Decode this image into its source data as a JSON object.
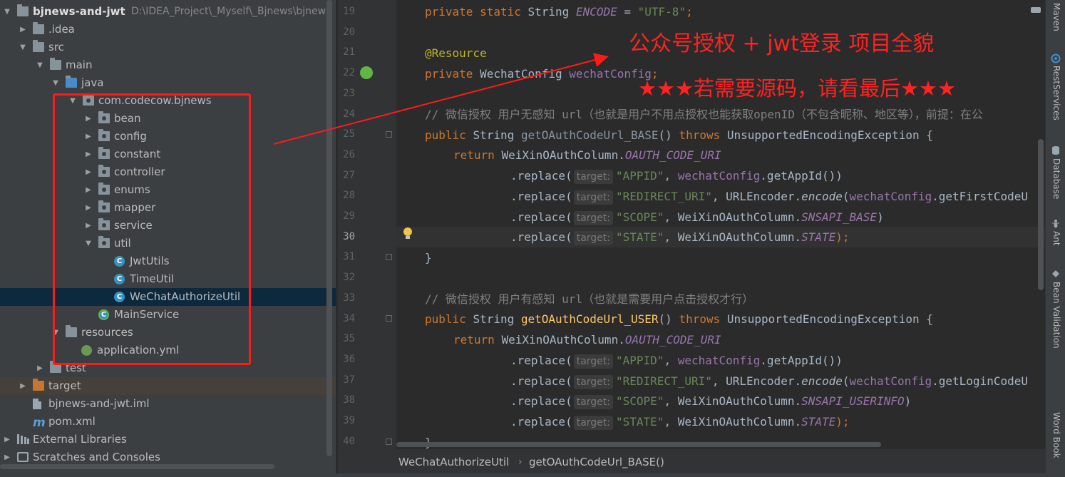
{
  "project_tree": {
    "rows": [
      {
        "label": "bjnews-and-jwt",
        "path": "D:\\IDEA_Project\\_Myself\\_Bjnews\\bjnews",
        "arrow": "down",
        "icon": "folder"
      },
      {
        "label": ".idea",
        "arrow": "right",
        "icon": "folder"
      },
      {
        "label": "src",
        "arrow": "down",
        "icon": "folder"
      },
      {
        "label": "main",
        "arrow": "down",
        "icon": "folder"
      },
      {
        "label": "java",
        "arrow": "down",
        "icon": "folder-source"
      },
      {
        "label": "com.codecow.bjnews",
        "arrow": "down",
        "icon": "package"
      },
      {
        "label": "bean",
        "arrow": "right",
        "icon": "package"
      },
      {
        "label": "config",
        "arrow": "right",
        "icon": "package"
      },
      {
        "label": "constant",
        "arrow": "right",
        "icon": "package"
      },
      {
        "label": "controller",
        "arrow": "right",
        "icon": "package"
      },
      {
        "label": "enums",
        "arrow": "right",
        "icon": "package"
      },
      {
        "label": "mapper",
        "arrow": "right",
        "icon": "package"
      },
      {
        "label": "service",
        "arrow": "right",
        "icon": "package"
      },
      {
        "label": "util",
        "arrow": "down",
        "icon": "package"
      },
      {
        "label": "JwtUtils",
        "icon": "class"
      },
      {
        "label": "TimeUtil",
        "icon": "class"
      },
      {
        "label": "WeChatAuthorizeUtil",
        "icon": "class",
        "selected": true
      },
      {
        "label": "MainService",
        "icon": "spring-class"
      },
      {
        "label": "resources",
        "arrow": "down",
        "icon": "folder-resources"
      },
      {
        "label": "application.yml",
        "icon": "spring-yml"
      },
      {
        "label": "test",
        "arrow": "right",
        "icon": "folder"
      },
      {
        "label": "target",
        "arrow": "right",
        "icon": "folder-excluded",
        "highlight": true
      },
      {
        "label": "bjnews-and-jwt.iml",
        "icon": "file"
      },
      {
        "label": "pom.xml",
        "icon": "maven"
      },
      {
        "label": "External Libraries",
        "arrow": "right",
        "icon": "libraries"
      },
      {
        "label": "Scratches and Consoles",
        "arrow": "right",
        "icon": "scratches"
      }
    ]
  },
  "editor": {
    "line_numbers": [
      "19",
      "20",
      "21",
      "22",
      "23",
      "24",
      "25",
      "26",
      "27",
      "28",
      "29",
      "30",
      "31",
      "32",
      "33",
      "34",
      "35",
      "36",
      "37",
      "38",
      "39",
      "40"
    ],
    "current_line": "30",
    "hint_label": "target:",
    "code": {
      "l19": {
        "kw": "private static ",
        "type": "String ",
        "field": "ENCODE",
        "eq": " = ",
        "str": "\"UTF-8\"",
        "semi": ";"
      },
      "l21": {
        "annotation": "@Resource"
      },
      "l22": {
        "kw": "private ",
        "type": "WechatConfig ",
        "field": "wechatConfig",
        "semi": ";"
      },
      "l24": {
        "comment": "// 微信授权 用户无感知 url（也就是用户不用点授权也能获取openID（不包含昵称、地区等），前提：在公"
      },
      "l25": {
        "kw": "public ",
        "type": "String ",
        "method": "getOAuthCodeUrl_BASE",
        "paren": "() ",
        "kw2": "throws ",
        "exc": "UnsupportedEncodingException {"
      },
      "l26": {
        "kw": "return ",
        "cls": "WeiXinOAuthColumn.",
        "const": "OAUTH_CODE_URI"
      },
      "l27": {
        "call": ".replace(",
        "str": "\"APPID\"",
        "comma": ", ",
        "obj": "wechatConfig",
        "rest": ".getAppId())"
      },
      "l28": {
        "call": ".replace(",
        "str": "\"REDIRECT_URI\"",
        "comma": ", ",
        "cls": "URLEncoder.",
        "static": "encode",
        "open": "(",
        "obj": "wechatConfig",
        "rest": ".getFirstCodeU"
      },
      "l29": {
        "call": ".replace(",
        "str": "\"SCOPE\"",
        "comma": ", ",
        "cls": "WeiXinOAuthColumn.",
        "const": "SNSAPI_BASE",
        "close": ")"
      },
      "l30": {
        "call": ".replace(",
        "str": "\"STATE\"",
        "comma": ", ",
        "cls": "WeiXinOAuthColumn.",
        "const": "STATE",
        "close": ");"
      },
      "l31": {
        "brace": "}"
      },
      "l33": {
        "comment": "// 微信授权 用户有感知 url（也就是需要用户点击授权才行）"
      },
      "l34": {
        "kw": "public ",
        "type": "String ",
        "method": "getOAuthCodeUrl_USER",
        "paren": "() ",
        "kw2": "throws ",
        "exc": "UnsupportedEncodingException {"
      },
      "l35": {
        "kw": "return ",
        "cls": "WeiXinOAuthColumn.",
        "const": "OAUTH_CODE_URI"
      },
      "l36": {
        "call": ".replace(",
        "str": "\"APPID\"",
        "comma": ", ",
        "obj": "wechatConfig",
        "rest": ".getAppId())"
      },
      "l37": {
        "call": ".replace(",
        "str": "\"REDIRECT_URI\"",
        "comma": ", ",
        "cls": "URLEncoder.",
        "static": "encode",
        "open": "(",
        "obj": "wechatConfig",
        "rest": ".getLoginCodeU"
      },
      "l38": {
        "call": ".replace(",
        "str": "\"SCOPE\"",
        "comma": ", ",
        "cls": "WeiXinOAuthColumn.",
        "const": "SNSAPI_USERINFO",
        "close": ")"
      },
      "l39": {
        "call": ".replace(",
        "str": "\"STATE\"",
        "comma": ", ",
        "cls": "WeiXinOAuthColumn.",
        "const": "STATE",
        "close": ");"
      },
      "l40": {
        "brace": "}"
      }
    }
  },
  "annotation": {
    "title": "公众号授权 + jwt登录 项目全貌",
    "note": "★★★若需要源码，请看最后★★★",
    "color": "#ff2222"
  },
  "right_toolbar": {
    "tabs": [
      "Maven",
      "RestServices",
      "Database",
      "Ant",
      "Bean Validation",
      "Word Book"
    ]
  },
  "breadcrumb": {
    "class_name": "WeChatAuthorizeUtil",
    "method_name": "getOAuthCodeUrl_BASE()"
  }
}
